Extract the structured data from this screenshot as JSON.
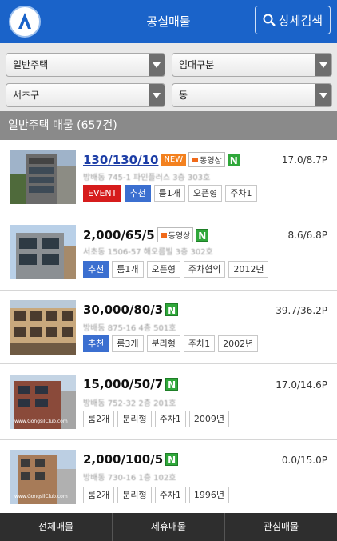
{
  "header": {
    "title": "공실매물",
    "search_label": "상세검색"
  },
  "filters": {
    "type": "일반주택",
    "rent": "임대구분",
    "district": "서초구",
    "dong": "동"
  },
  "section": {
    "label": "일반주택 매물 (657건)"
  },
  "listings": [
    {
      "price": "130/130/10",
      "new_label": "NEW",
      "video_label": "동영상",
      "n_label": "N",
      "area": "17.0/8.7P",
      "address": "방배동 745-1 파인플러스 3층 303호",
      "chips": [
        "EVENT",
        "추천",
        "룸1개",
        "오픈형",
        "주차1"
      ]
    },
    {
      "price": "2,000/65/5",
      "video_label": "동영상",
      "n_label": "N",
      "area": "8.6/6.8P",
      "address": "서초동 1506-57 해오름빌 3층 302호",
      "chips": [
        "추천",
        "룸1개",
        "오픈형",
        "주차협의",
        "2012년"
      ]
    },
    {
      "price": "30,000/80/3",
      "n_label": "N",
      "area": "39.7/36.2P",
      "address": "방배동 875-16 4층 501호",
      "chips": [
        "추천",
        "룸3개",
        "분리형",
        "주차1",
        "2002년"
      ]
    },
    {
      "price": "15,000/50/7",
      "n_label": "N",
      "area": "17.0/14.6P",
      "address": "방배동 752-32 2층 201호",
      "chips": [
        "룸2개",
        "분리형",
        "주차1",
        "2009년"
      ]
    },
    {
      "price": "2,000/100/5",
      "n_label": "N",
      "area": "0.0/15.0P",
      "address": "방배동 730-16 1층 102호",
      "chips": [
        "룸2개",
        "분리형",
        "주차1",
        "1996년"
      ]
    }
  ],
  "bottom_nav": [
    "전체매물",
    "제휴매물",
    "관심매물"
  ],
  "colors": {
    "header_blue": "#1a63c9",
    "tag_green": "#2fa73a",
    "tag_orange": "#f3811f",
    "chip_blue": "#3b6fd0",
    "chip_red": "#d61c1c"
  }
}
